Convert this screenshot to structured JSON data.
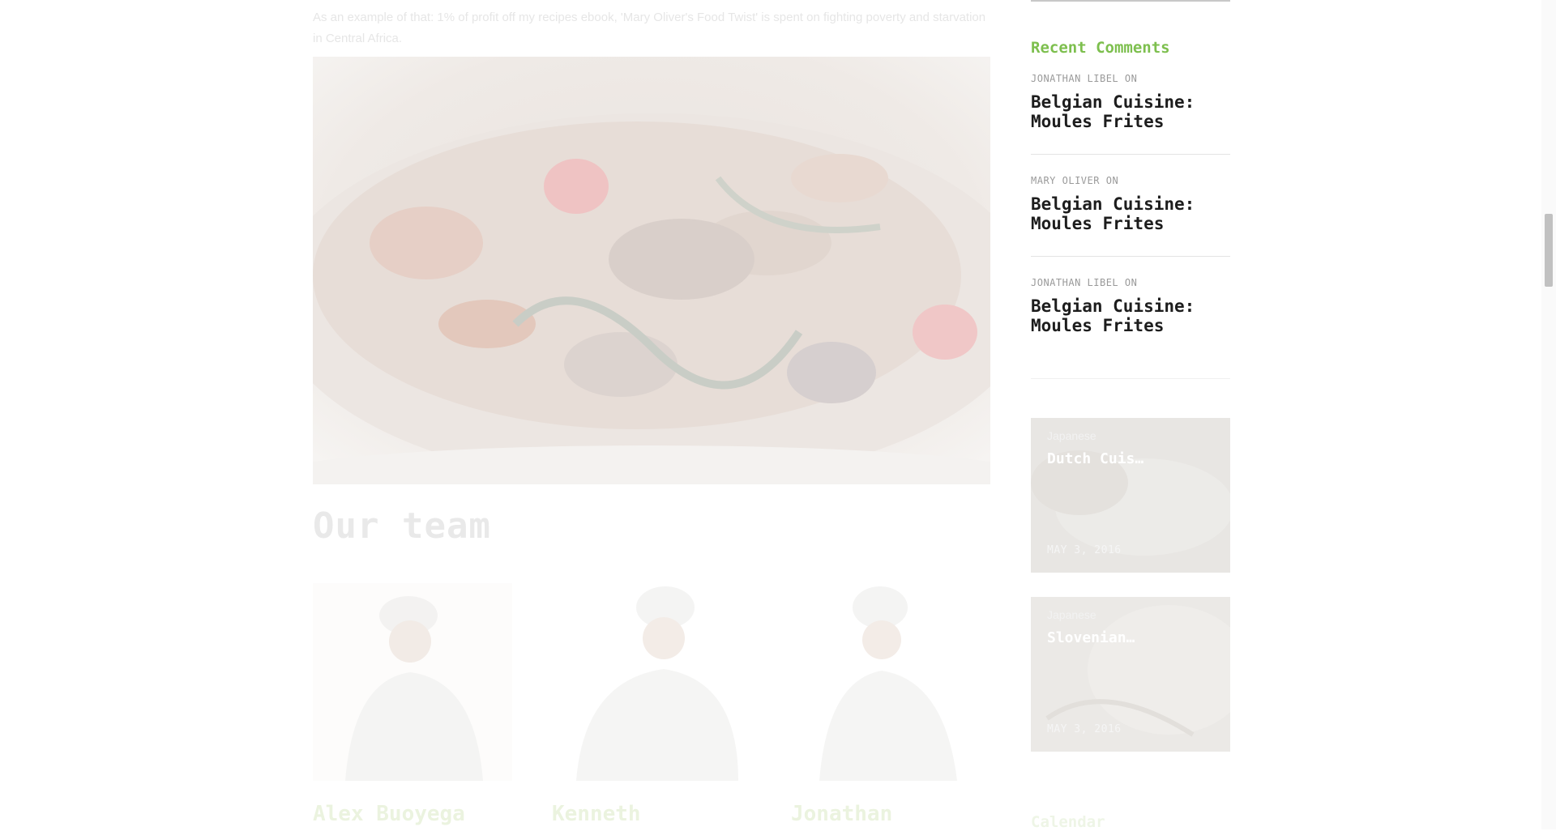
{
  "main": {
    "intro_text": "As an example of that: 1% of profit off my recipes ebook, 'Mary Oliver's Food Twist' is spent on fighting poverty and starvation in Central Africa.",
    "section_title": "Our team",
    "team": [
      {
        "name": "Alex Buoyega"
      },
      {
        "name": "Kenneth"
      },
      {
        "name": "Jonathan"
      }
    ]
  },
  "sidebar": {
    "recent_comments_title": "Recent Comments",
    "comments": [
      {
        "author": "JONATHAN LIBEL",
        "on": "ON",
        "post": "Belgian Cuisine: Moules Frites"
      },
      {
        "author": "MARY OLIVER",
        "on": "ON",
        "post": "Belgian Cuisine: Moules Frites"
      },
      {
        "author": "JONATHAN LIBEL",
        "on": "ON",
        "post": "Belgian Cuisine: Moules Frites"
      }
    ],
    "posts": [
      {
        "category": "Japanese",
        "title": "Dutch Cuis…",
        "date": "MAY 3, 2016"
      },
      {
        "category": "Japanese",
        "title": "Slovenian…",
        "date": "MAY 3, 2016"
      }
    ],
    "calendar_title": "Calendar"
  },
  "colors": {
    "accent": "#7dbf4e",
    "comment_link": "#1d1d1d",
    "meta": "#9a9a9a"
  },
  "icons": {
    "scrollbar": "vertical-scrollbar"
  }
}
